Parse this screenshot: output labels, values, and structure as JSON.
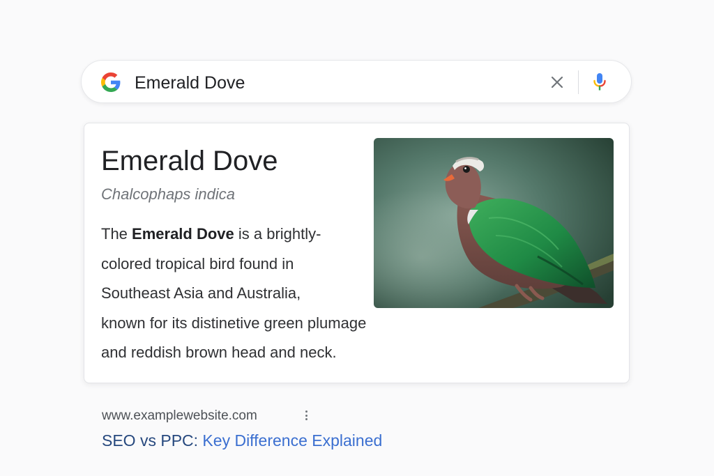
{
  "search": {
    "query": "Emerald Dove",
    "logo_icon": "google-g-icon",
    "clear_icon": "close-icon",
    "voice_icon": "microphone-icon"
  },
  "knowledge_panel": {
    "title": "Emerald Dove",
    "scientific_name": "Chalcophaps indica",
    "description": {
      "line1_prefix": "The ",
      "line1_bold": "Emerald Dove",
      "line1_suffix": " is a brightly-",
      "line2": "colored tropical bird found in",
      "line3": "Southeast Asia and Australia,",
      "line4": "known for its distinetive green plumage",
      "line5": "and reddish brown head and neck."
    },
    "image": "emerald-dove-photo"
  },
  "result": {
    "url": "www.examplewebsite.com",
    "title_part1": "SEO vs PPC:",
    "title_part2": " Key Difference Explained",
    "menu_icon": "more-vert-icon"
  },
  "colors": {
    "google_blue": "#4285F4",
    "google_red": "#EA4335",
    "google_yellow": "#FBBC05",
    "google_green": "#34A853",
    "link_dark": "#26487e",
    "link_blue": "#3b6fd0"
  }
}
